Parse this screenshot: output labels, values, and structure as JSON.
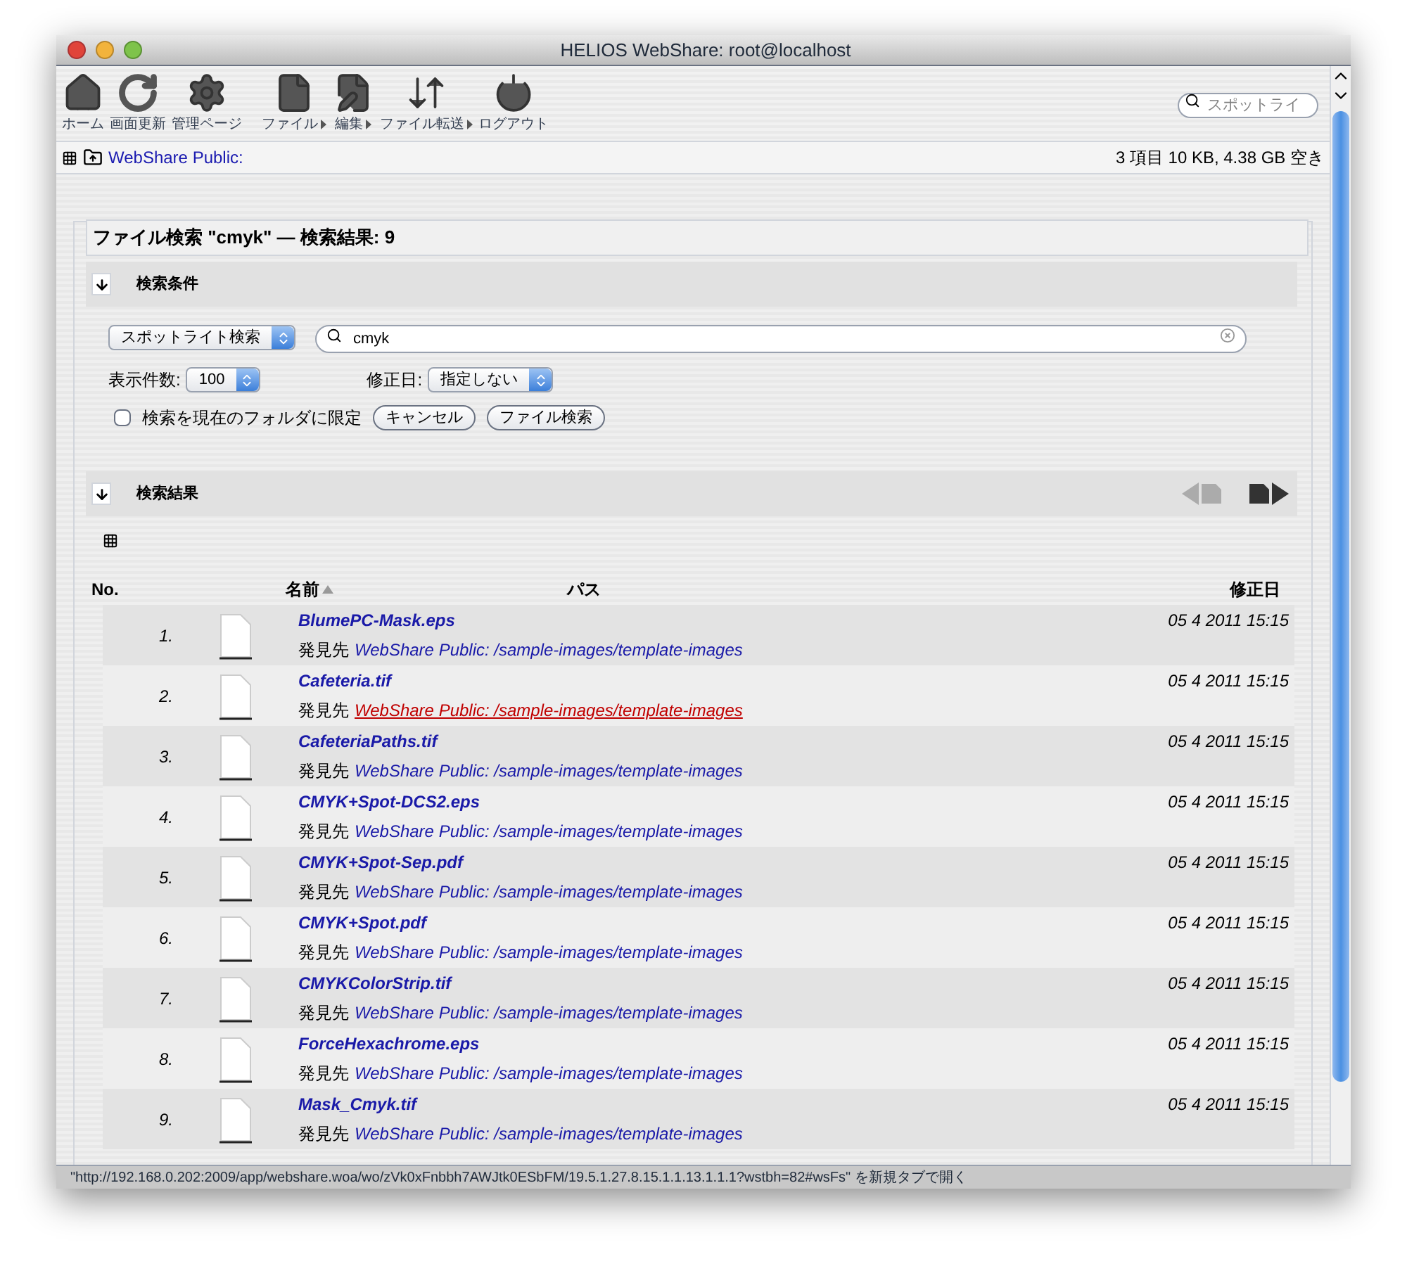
{
  "window": {
    "title": "HELIOS WebShare: root@localhost"
  },
  "toolbar": [
    {
      "label": "ホーム",
      "kind": "home",
      "has_menu": false
    },
    {
      "label": "画面更新",
      "kind": "refresh",
      "has_menu": false
    },
    {
      "label": "管理ページ",
      "kind": "settings",
      "has_menu": false
    },
    {
      "label": "ファイル",
      "kind": "file",
      "has_menu": true
    },
    {
      "label": "編集",
      "kind": "edit",
      "has_menu": true
    },
    {
      "label": "ファイル転送",
      "kind": "transfer",
      "has_menu": true
    },
    {
      "label": "ログアウト",
      "kind": "logout",
      "has_menu": false
    }
  ],
  "toolbar_search": {
    "placeholder": "スポットライ"
  },
  "path_bar": {
    "location": "WebShare Public:",
    "info": "3 項目 10 KB, 4.38 GB 空き"
  },
  "search_panel": {
    "title": "ファイル検索 \"cmyk\" — 検索結果: 9",
    "conditions_heading": "検索条件",
    "search_type": "スポットライト検索",
    "query": "cmyk",
    "count_label": "表示件数:",
    "count_value": "100",
    "date_label": "修正日:",
    "date_value": "指定しない",
    "limit_checkbox": {
      "label": "検索を現在のフォルダに限定",
      "checked": false
    },
    "buttons": [
      "キャンセル",
      "ファイル検索"
    ]
  },
  "results": {
    "heading": "検索結果",
    "prev_disabled": true,
    "next_disabled": false,
    "columns": [
      "No.",
      "名前",
      "パス",
      "修正日"
    ],
    "rows": [
      {
        "no": "1.",
        "name": "BlumePC-Mask.eps",
        "found_label": "発見先",
        "path": "WebShare Public: /sample-images/template-images",
        "date": "05 4 2011 15:15",
        "hovered": false
      },
      {
        "no": "2.",
        "name": "Cafeteria.tif",
        "found_label": "発見先",
        "path": "WebShare Public: /sample-images/template-images",
        "date": "05 4 2011 15:15",
        "hovered": true
      },
      {
        "no": "3.",
        "name": "CafeteriaPaths.tif",
        "found_label": "発見先",
        "path": "WebShare Public: /sample-images/template-images",
        "date": "05 4 2011 15:15",
        "hovered": false
      },
      {
        "no": "4.",
        "name": "CMYK+Spot-DCS2.eps",
        "found_label": "発見先",
        "path": "WebShare Public: /sample-images/template-images",
        "date": "05 4 2011 15:15",
        "hovered": false
      },
      {
        "no": "5.",
        "name": "CMYK+Spot-Sep.pdf",
        "found_label": "発見先",
        "path": "WebShare Public: /sample-images/template-images",
        "date": "05 4 2011 15:15",
        "hovered": false
      },
      {
        "no": "6.",
        "name": "CMYK+Spot.pdf",
        "found_label": "発見先",
        "path": "WebShare Public: /sample-images/template-images",
        "date": "05 4 2011 15:15",
        "hovered": false
      },
      {
        "no": "7.",
        "name": "CMYKColorStrip.tif",
        "found_label": "発見先",
        "path": "WebShare Public: /sample-images/template-images",
        "date": "05 4 2011 15:15",
        "hovered": false
      },
      {
        "no": "8.",
        "name": "ForceHexachrome.eps",
        "found_label": "発見先",
        "path": "WebShare Public: /sample-images/template-images",
        "date": "05 4 2011 15:15",
        "hovered": false
      },
      {
        "no": "9.",
        "name": "Mask_Cmyk.tif",
        "found_label": "発見先",
        "path": "WebShare Public: /sample-images/template-images",
        "date": "05 4 2011 15:15",
        "hovered": false
      }
    ]
  },
  "status_bar": {
    "text": "\"http://192.168.0.202:2009/app/webshare.woa/wo/zVk0xFnbbh7AWJtk0ESbFM/19.5.1.27.8.15.1.1.13.1.1.1?wstbh=82#wsFs\" を新規タブで開く"
  }
}
